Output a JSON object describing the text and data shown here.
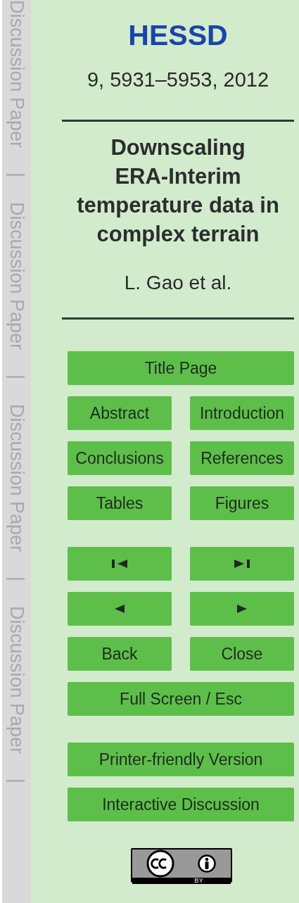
{
  "margin_strip": [
    "Discussion Paper",
    "|",
    "Discussion Paper",
    "|",
    "Discussion Paper",
    "|",
    "Discussion Paper",
    "|"
  ],
  "journal": "HESSD",
  "citation": "9, 5931–5953, 2012",
  "title": [
    "Downscaling",
    "ERA-Interim",
    "temperature data in",
    "complex terrain"
  ],
  "authors": "L. Gao et al.",
  "nav_sections": [
    [
      [
        {
          "kind": "text",
          "label": "Title Page"
        }
      ],
      [
        {
          "kind": "text",
          "label": "Abstract"
        },
        {
          "kind": "text",
          "label": "Introduction"
        }
      ],
      [
        {
          "kind": "text",
          "label": "Conclusions"
        },
        {
          "kind": "text",
          "label": "References"
        }
      ],
      [
        {
          "kind": "text",
          "label": "Tables"
        },
        {
          "kind": "text",
          "label": "Figures"
        }
      ]
    ],
    [
      [
        {
          "kind": "first"
        },
        {
          "kind": "last"
        }
      ],
      [
        {
          "kind": "prev"
        },
        {
          "kind": "next"
        }
      ],
      [
        {
          "kind": "text",
          "label": "Back"
        },
        {
          "kind": "text",
          "label": "Close"
        }
      ],
      [
        {
          "kind": "text",
          "label": "Full Screen / Esc"
        }
      ]
    ],
    [
      [
        {
          "kind": "text",
          "label": "Printer-friendly Version"
        }
      ],
      [
        {
          "kind": "text",
          "label": "Interactive Discussion"
        }
      ]
    ]
  ],
  "license_badge": {
    "caption": "BY"
  }
}
